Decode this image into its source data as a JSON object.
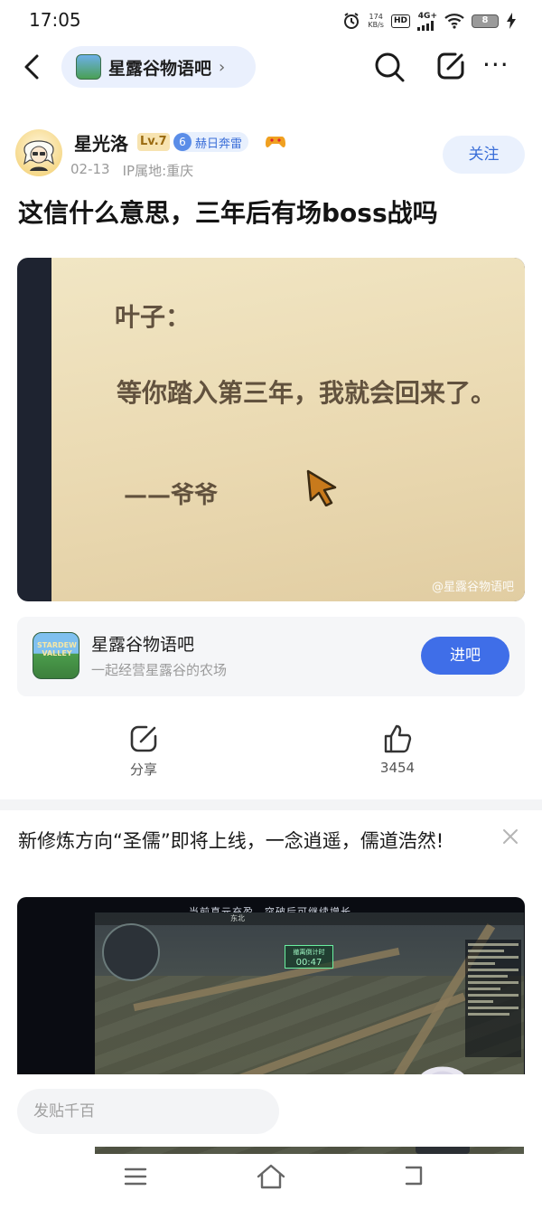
{
  "status_bar": {
    "time": "17:05",
    "net_speed_value": "174",
    "net_speed_unit": "KB/s",
    "hd": "HD",
    "network": "4G+",
    "battery": "8"
  },
  "nav": {
    "forum_name": "星露谷物语吧",
    "chevron": "›",
    "more": "···"
  },
  "author": {
    "name": "星光洛",
    "level": "Lv.7",
    "honor_level": "6",
    "honor_title": "赫日奔雷",
    "date": "02-13",
    "ip_location": "IP属地:重庆",
    "follow_label": "关注"
  },
  "post": {
    "title": "这信什么意思，三年后有场boss战吗",
    "image_text": {
      "line1": "叶子：",
      "line2": "等你踏入第三年，我就会回来了。",
      "line3": "——爷爷",
      "watermark": "@星露谷物语吧"
    }
  },
  "forum_card": {
    "logo_text": "STARDEW VALLEY",
    "name": "星露谷物语吧",
    "subtitle": "一起经营星露谷的农场",
    "enter_label": "进吧"
  },
  "actions": {
    "share_label": "分享",
    "like_count": "3454"
  },
  "ad": {
    "title": "新修炼方向“圣儒”即将上线，一念逍遥，儒道浩然!",
    "media_top_text": "当前真元充盈，突破后可继续增长",
    "game_timer_label": "撤离倒计时",
    "game_timer": "00:47",
    "game_hud_direction": "东北"
  },
  "comment_bar": {
    "placeholder": "发贴千百"
  },
  "colors": {
    "accent_blue": "#3f6ee8",
    "follow_text": "#3a6ed8",
    "pill_bg": "#eaf0fd"
  },
  "icons": {
    "back": "back-arrow-icon",
    "search": "search-icon",
    "edit": "edit-icon",
    "share": "share-icon",
    "like": "thumbs-up-icon",
    "close": "close-icon"
  }
}
